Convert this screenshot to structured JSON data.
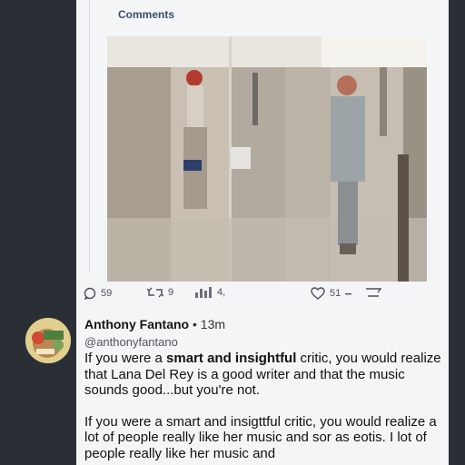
{
  "quoted_post": {
    "comments_label": "Comments",
    "metrics": {
      "replies": "59",
      "reposts": "9",
      "views": "4,",
      "likes": "51"
    }
  },
  "post": {
    "author_name": "Anthony Fantano",
    "separator": " • ",
    "time": "13m",
    "handle": "@anthonyfantano",
    "para1_before": "If you were a ",
    "para1_bold": "smart and insightful",
    "para1_after": " critic, you would realize that Lana Del Rey is a good writer and that the music sounds good...but you're not.",
    "para2": "If you were a smart and insigttful critic, you would realize a lot of people really like her music and sor as eotis. I lot of people really like her music and"
  },
  "colors": {
    "background": "#2a2f36",
    "card": "#f4f5f7",
    "link": "#3d4c6b"
  }
}
